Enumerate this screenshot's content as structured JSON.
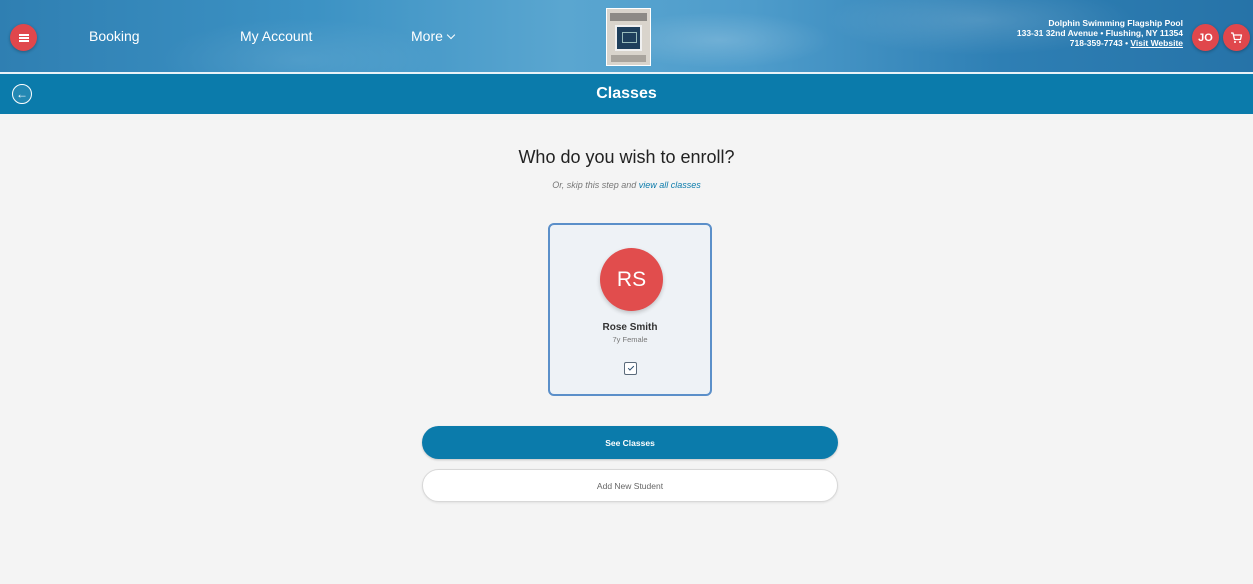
{
  "header": {
    "nav": {
      "booking": "Booking",
      "my_account": "My Account",
      "more": "More"
    },
    "pool": {
      "name": "Dolphin Swimming Flagship Pool",
      "address": "133-31 32nd Avenue • Flushing, NY 11354",
      "phone": "718-359-7743",
      "separator": " • ",
      "visit": "Visit Website"
    },
    "user_initials": "JO"
  },
  "subbar": {
    "title": "Classes"
  },
  "main": {
    "heading": "Who do you wish to enroll?",
    "skip_prefix": "Or, skip this step and ",
    "skip_link": "view all classes",
    "student": {
      "initials": "RS",
      "name": "Rose Smith",
      "meta": "7y Female",
      "selected": true
    },
    "see_classes_label": "See Classes",
    "add_student_label": "Add New Student"
  },
  "colors": {
    "accent": "#0b7bab",
    "brand_red": "#e0474c",
    "avatar_red": "#e14d4d"
  }
}
